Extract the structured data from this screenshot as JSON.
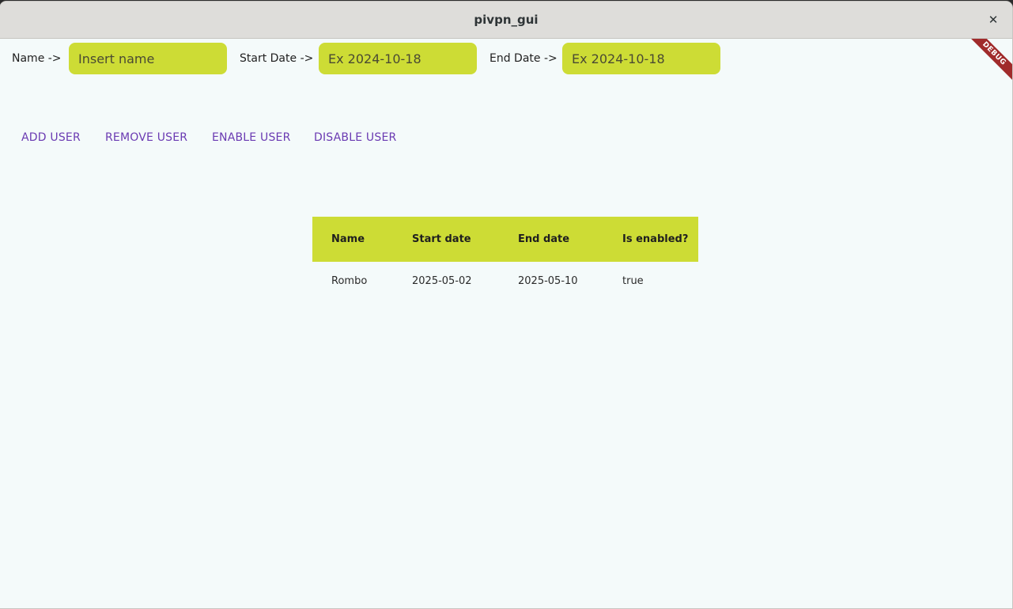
{
  "window": {
    "title": "pivpn_gui",
    "close_glyph": "✕",
    "debug_label": "DEBUG"
  },
  "form": {
    "name_label": "Name ->",
    "name_placeholder": "Insert name",
    "start_label": "Start Date ->",
    "start_placeholder": "Ex 2024-10-18",
    "end_label": "End Date ->",
    "end_placeholder": "Ex 2024-10-18"
  },
  "actions": {
    "add": "ADD USER",
    "remove": "REMOVE USER",
    "enable": "ENABLE USER",
    "disable": "DISABLE USER"
  },
  "table": {
    "headers": [
      "Name",
      "Start date",
      "End date",
      "Is enabled?"
    ],
    "rows": [
      [
        "Rombo",
        "2025-05-02",
        "2025-05-10",
        "true"
      ]
    ]
  },
  "colors": {
    "accent": "#cddc35",
    "button_text": "#6a3ab2",
    "debug_ribbon": "#a02b2b"
  }
}
